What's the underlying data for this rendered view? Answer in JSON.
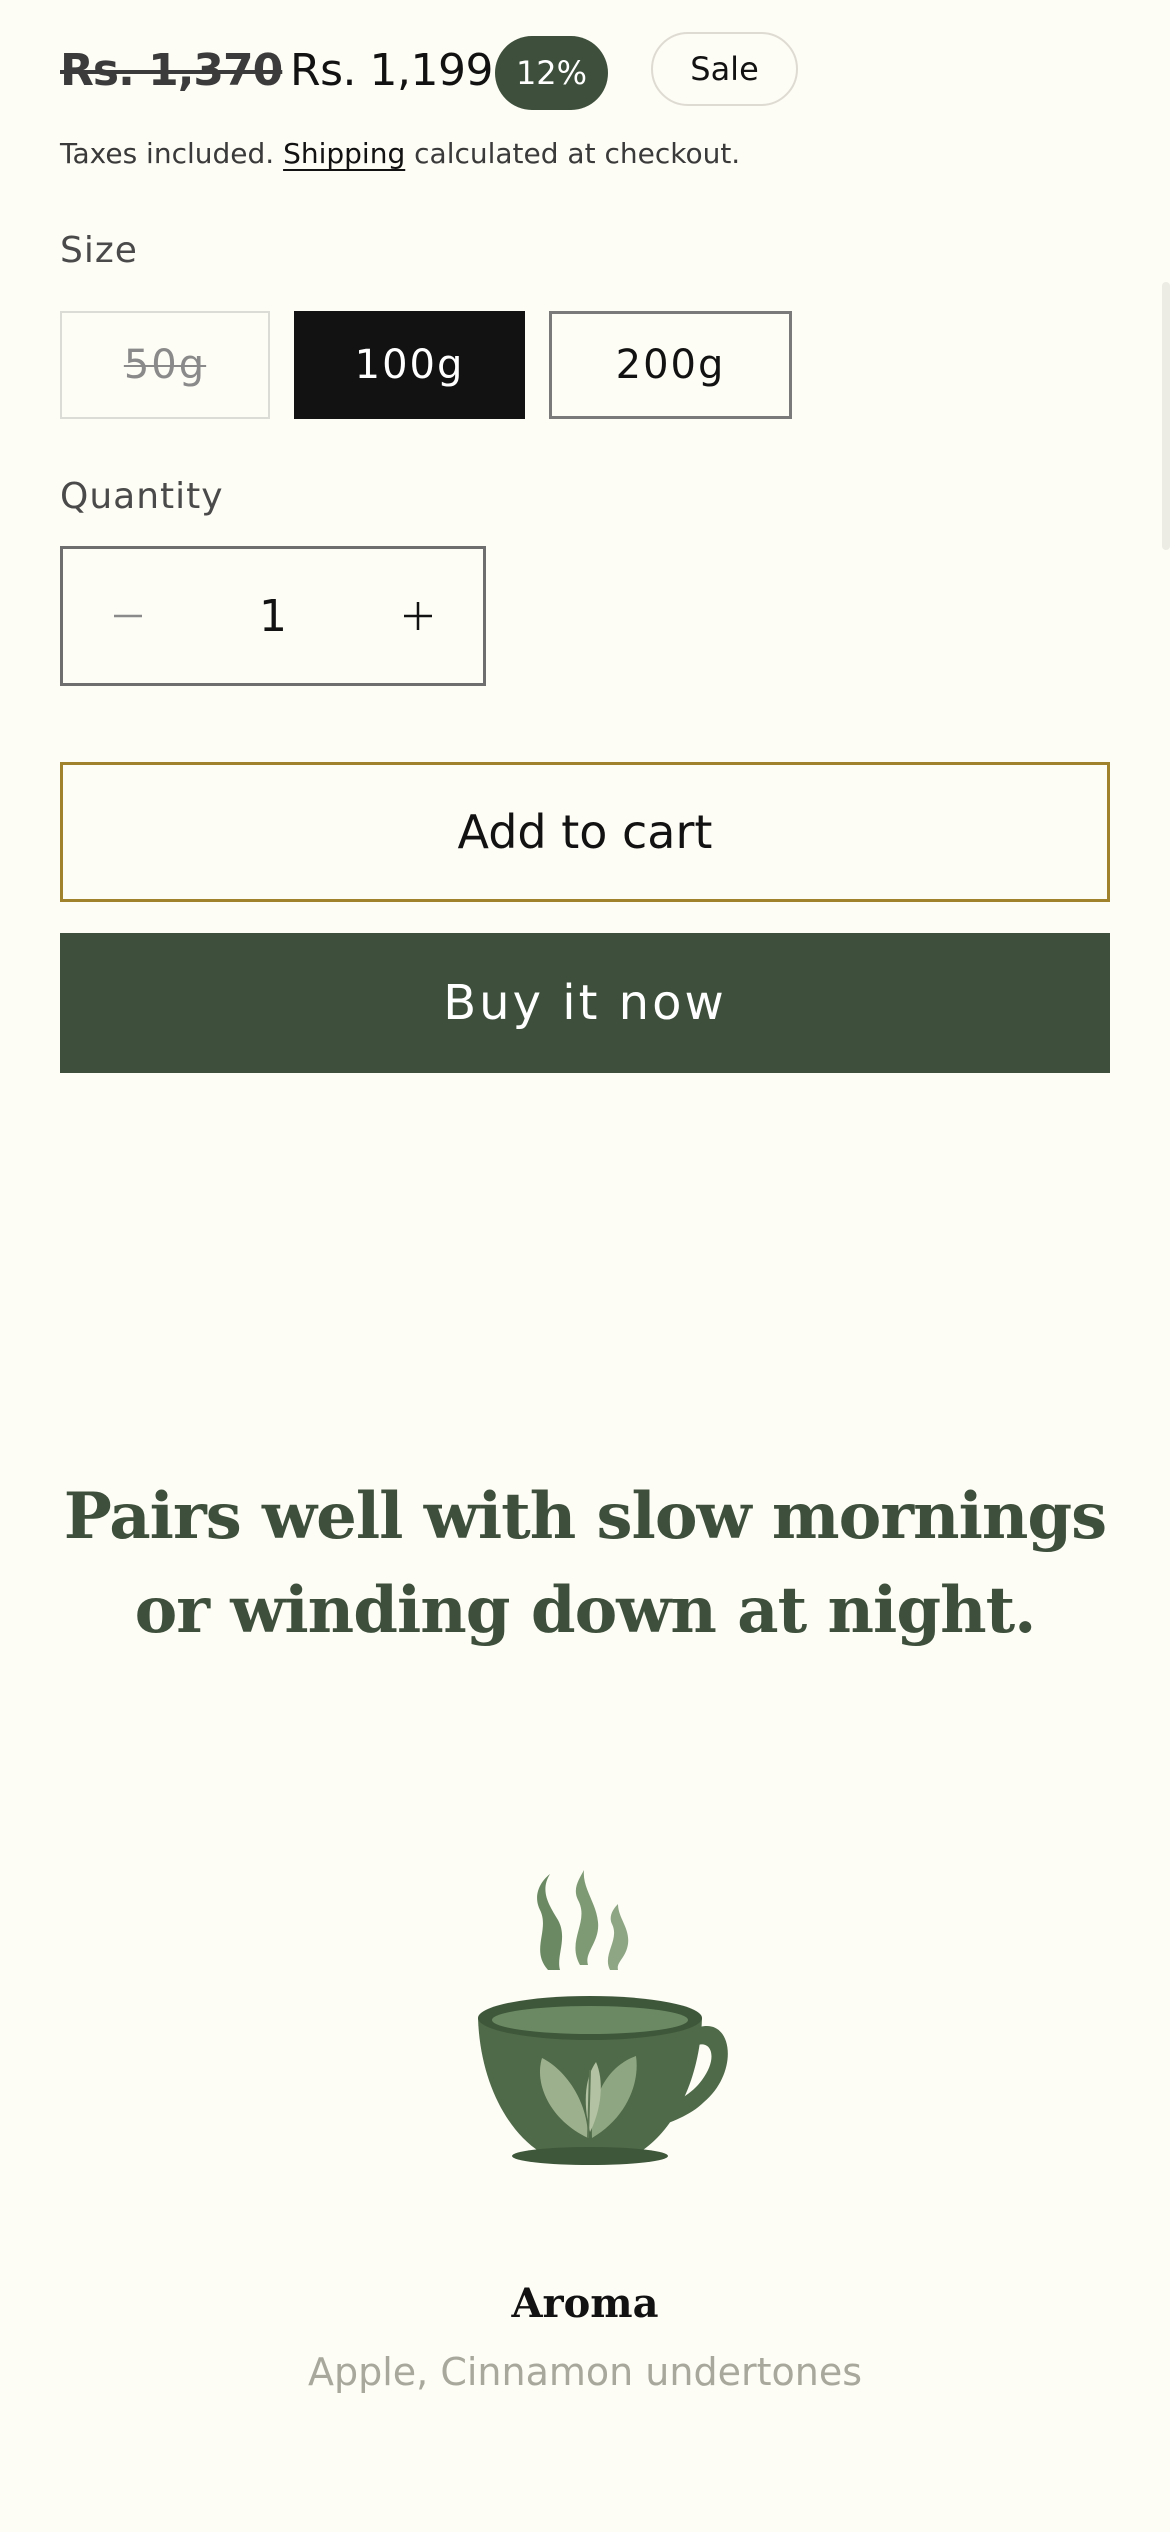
{
  "price": {
    "compare_at": "Rs. 1,370",
    "current": "Rs. 1,199",
    "discount_badge": "12%",
    "sale_badge": "Sale"
  },
  "tax_note": {
    "prefix": "Taxes included. ",
    "link": "Shipping",
    "suffix": " calculated at checkout."
  },
  "size": {
    "label": "Size",
    "options": [
      "50g",
      "100g",
      "200g"
    ],
    "selected": "100g",
    "unavailable": [
      "50g"
    ]
  },
  "quantity": {
    "label": "Quantity",
    "value": "1",
    "minus_symbol": "−",
    "plus_symbol": "+"
  },
  "actions": {
    "add_to_cart": "Add to cart",
    "buy_now": "Buy it now"
  },
  "tagline": "Pairs well with slow mornings or winding down at night.",
  "feature": {
    "icon": "tea-cup-icon",
    "title": "Aroma",
    "description": "Apple, Cinnamon undertones"
  },
  "colors": {
    "background": "#fdfcf5",
    "brand_green": "#3e503c",
    "cart_border": "#a0822d",
    "selected_option": "#121212",
    "muted_text": "#a8a89c"
  }
}
